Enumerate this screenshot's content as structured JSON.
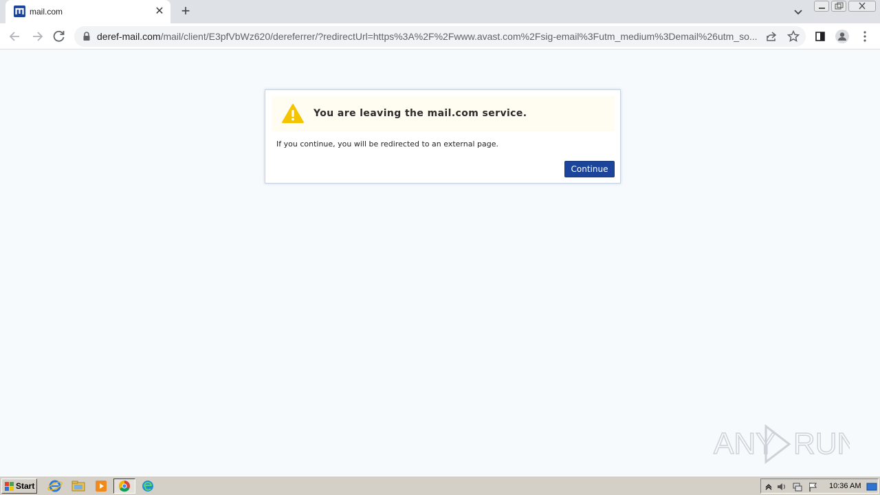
{
  "browser": {
    "tab": {
      "title": "mail.com",
      "favicon": "mail-com-logo-icon"
    },
    "url": {
      "host": "deref-mail.com",
      "rest": "/mail/client/E3pfVbWz620/dereferrer/?redirectUrl=https%3A%2F%2Fwww.avast.com%2Fsig-email%3Futm_medium%3Demail%26utm_so..."
    }
  },
  "dialog": {
    "title": "You are leaving the mail.com service.",
    "message": "If you continue, you will be redirected to an external page.",
    "continue_label": "Continue",
    "icon": "warning-icon"
  },
  "watermark": {
    "text": "ANY RUN"
  },
  "taskbar": {
    "start_label": "Start",
    "apps": [
      "internet-explorer-icon",
      "file-explorer-icon",
      "media-player-icon",
      "chrome-icon",
      "edge-icon"
    ],
    "clock": "10:36 AM"
  },
  "colors": {
    "accent": "#1c449b",
    "warning": "#f5c400",
    "page_bg": "#f7fafd",
    "dialog_header_bg": "#fffcf2"
  }
}
